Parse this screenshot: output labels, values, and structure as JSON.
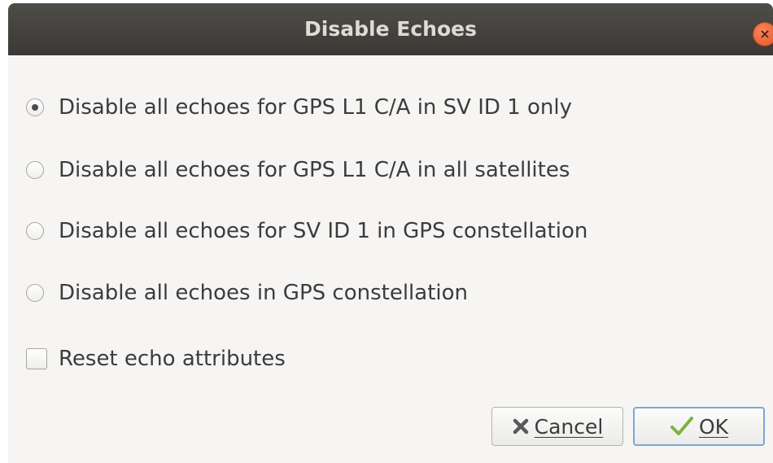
{
  "window": {
    "title": "Disable Echoes",
    "close_glyph": "×"
  },
  "options": [
    {
      "label": "Disable all echoes for GPS L1 C/A in SV ID 1 only",
      "selected": true
    },
    {
      "label": "Disable all echoes for GPS L1 C/A in all satellites",
      "selected": false
    },
    {
      "label": "Disable all echoes for SV ID 1 in GPS constellation",
      "selected": false
    },
    {
      "label": "Disable all echoes in GPS constellation",
      "selected": false
    }
  ],
  "checkbox": {
    "label": "Reset echo attributes",
    "checked": false
  },
  "buttons": {
    "cancel": {
      "label": "Cancel",
      "icon": "x-icon"
    },
    "ok": {
      "label": "OK",
      "icon": "checkmark-icon"
    }
  },
  "colors": {
    "titlebar": "#3c3b37",
    "close": "#e9663a",
    "background": "#f6f5f4",
    "ok_border": "#7aa7d8",
    "ok_check": "#7cb342"
  }
}
